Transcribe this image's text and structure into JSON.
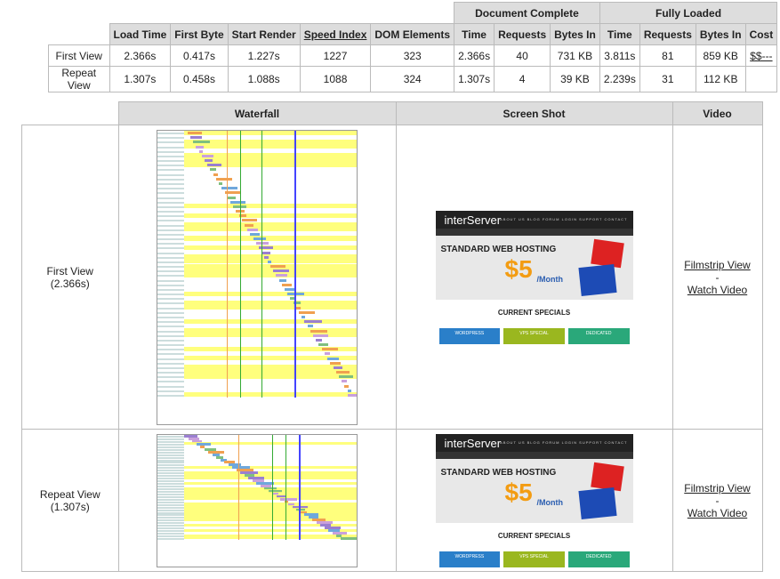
{
  "summary": {
    "group_headers": [
      "Document Complete",
      "Fully Loaded"
    ],
    "columns": [
      "Load Time",
      "First Byte",
      "Start Render",
      "Speed Index",
      "DOM Elements",
      "Time",
      "Requests",
      "Bytes In",
      "Time",
      "Requests",
      "Bytes In",
      "Cost"
    ],
    "rows": [
      {
        "label": "First View",
        "cells": [
          "2.366s",
          "0.417s",
          "1.227s",
          "1227",
          "323",
          "2.366s",
          "40",
          "731 KB",
          "3.811s",
          "81",
          "859 KB",
          "$$---"
        ]
      },
      {
        "label": "Repeat View",
        "cells": [
          "1.307s",
          "0.458s",
          "1.088s",
          "1088",
          "324",
          "1.307s",
          "4",
          "39 KB",
          "2.239s",
          "31",
          "112 KB",
          ""
        ]
      }
    ]
  },
  "results": {
    "headers": {
      "waterfall": "Waterfall",
      "screenshot": "Screen Shot",
      "video": "Video"
    },
    "rows": [
      {
        "label": "First View",
        "time": "(2.366s)",
        "filmstrip": "Filmstrip View",
        "dash": "-",
        "watch": "Watch Video"
      },
      {
        "label": "Repeat View",
        "time": "(1.307s)",
        "filmstrip": "Filmstrip View",
        "dash": "-",
        "watch": "Watch Video"
      }
    ]
  },
  "screenshot": {
    "logo": "interServer",
    "nav": "ABOUT US   BLOG   FORUM   LOGIN   SUPPORT   CONTACT",
    "headline": "STANDARD WEB HOSTING",
    "price": "$5",
    "per": "/Month",
    "specials": "CURRENT SPECIALS",
    "cards": [
      "WORDPRESS",
      "VPS SPECIAL",
      "DEDICATED"
    ]
  },
  "colors": {
    "header_bg": "#dddddd",
    "border": "#bbbbbb",
    "stripe": "#ffff66",
    "card_blue": "#2a7fc9",
    "card_green": "#9ab71f",
    "card_teal": "#2aa87a"
  }
}
